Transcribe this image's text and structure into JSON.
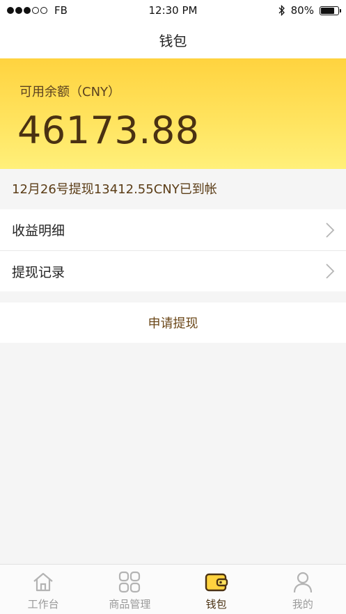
{
  "status_bar": {
    "carrier": "FB",
    "time": "12:30 PM",
    "battery_percent": "80%",
    "battery_level": 0.8,
    "signal_bars_on": 3,
    "signal_bars_total": 5
  },
  "nav": {
    "title": "钱包"
  },
  "balance": {
    "label": "可用余额（CNY）",
    "amount": "46173.88"
  },
  "notice": {
    "text": "12月26号提现13412.55CNY已到帐"
  },
  "menu": {
    "items": [
      {
        "label": "收益明细"
      },
      {
        "label": "提现记录"
      }
    ]
  },
  "actions": {
    "withdraw_label": "申请提现"
  },
  "tabs": [
    {
      "label": "工作台",
      "icon": "home-icon",
      "active": false
    },
    {
      "label": "商品管理",
      "icon": "grid-icon",
      "active": false
    },
    {
      "label": "钱包",
      "icon": "wallet-icon",
      "active": true
    },
    {
      "label": "我的",
      "icon": "user-icon",
      "active": false
    }
  ],
  "colors": {
    "accent_dark": "#4a3112",
    "card_gradient_top": "#ffd33f",
    "card_gradient_bottom": "#fff07a",
    "inactive_tab": "#9a9a9a"
  }
}
